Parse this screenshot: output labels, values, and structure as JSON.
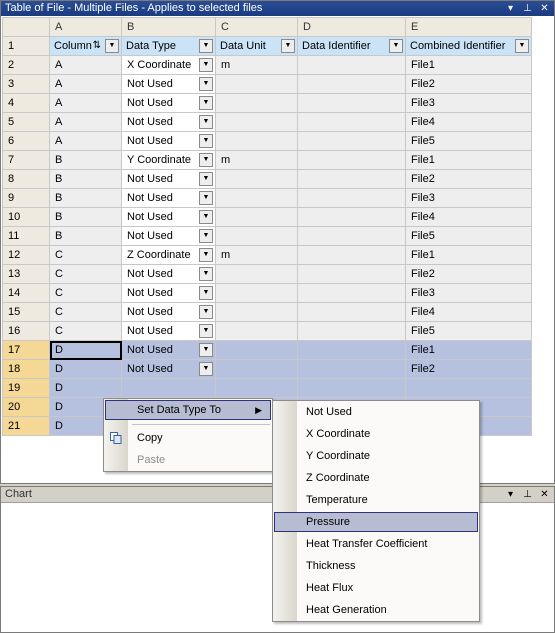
{
  "table_panel": {
    "title": "Table of File - Multiple Files - Applies to selected files",
    "buttons": [
      "▾",
      "⊥",
      "✕"
    ]
  },
  "columns": [
    "A",
    "B",
    "C",
    "D",
    "E"
  ],
  "header_row": {
    "row_number": "1",
    "column": "Column",
    "data_type": "Data Type",
    "data_unit": "Data Unit",
    "data_identifier": "Data Identifier",
    "combined_identifier": "Combined Identifier"
  },
  "rows": [
    {
      "n": "2",
      "a": "A",
      "b": "X Coordinate",
      "c": "m",
      "d": "",
      "e": "File1"
    },
    {
      "n": "3",
      "a": "A",
      "b": "Not Used",
      "c": "",
      "d": "",
      "e": "File2"
    },
    {
      "n": "4",
      "a": "A",
      "b": "Not Used",
      "c": "",
      "d": "",
      "e": "File3"
    },
    {
      "n": "5",
      "a": "A",
      "b": "Not Used",
      "c": "",
      "d": "",
      "e": "File4"
    },
    {
      "n": "6",
      "a": "A",
      "b": "Not Used",
      "c": "",
      "d": "",
      "e": "File5"
    },
    {
      "n": "7",
      "a": "B",
      "b": "Y Coordinate",
      "c": "m",
      "d": "",
      "e": "File1"
    },
    {
      "n": "8",
      "a": "B",
      "b": "Not Used",
      "c": "",
      "d": "",
      "e": "File2"
    },
    {
      "n": "9",
      "a": "B",
      "b": "Not Used",
      "c": "",
      "d": "",
      "e": "File3"
    },
    {
      "n": "10",
      "a": "B",
      "b": "Not Used",
      "c": "",
      "d": "",
      "e": "File4"
    },
    {
      "n": "11",
      "a": "B",
      "b": "Not Used",
      "c": "",
      "d": "",
      "e": "File5"
    },
    {
      "n": "12",
      "a": "C",
      "b": "Z Coordinate",
      "c": "m",
      "d": "",
      "e": "File1"
    },
    {
      "n": "13",
      "a": "C",
      "b": "Not Used",
      "c": "",
      "d": "",
      "e": "File2"
    },
    {
      "n": "14",
      "a": "C",
      "b": "Not Used",
      "c": "",
      "d": "",
      "e": "File3"
    },
    {
      "n": "15",
      "a": "C",
      "b": "Not Used",
      "c": "",
      "d": "",
      "e": "File4"
    },
    {
      "n": "16",
      "a": "C",
      "b": "Not Used",
      "c": "",
      "d": "",
      "e": "File5"
    },
    {
      "n": "17",
      "a": "D",
      "b": "Not Used",
      "c": "",
      "d": "",
      "e": "File1",
      "selected": true
    },
    {
      "n": "18",
      "a": "D",
      "b": "Not Used",
      "c": "",
      "d": "",
      "e": "File2",
      "selected": true
    },
    {
      "n": "19",
      "a": "D",
      "b": "",
      "c": "",
      "d": "",
      "e": "",
      "selected": true
    },
    {
      "n": "20",
      "a": "D",
      "b": "",
      "c": "",
      "d": "",
      "e": "",
      "selected": true
    },
    {
      "n": "21",
      "a": "D",
      "b": "",
      "c": "",
      "d": "",
      "e": "",
      "selected": true
    }
  ],
  "chart_panel": {
    "title": "Chart",
    "buttons": [
      "▾",
      "⊥",
      "✕"
    ]
  },
  "context_menu": {
    "set_data_type": "Set Data Type To",
    "copy": "Copy",
    "paste": "Paste"
  },
  "submenu": {
    "items": [
      "Not Used",
      "X Coordinate",
      "Y Coordinate",
      "Z Coordinate",
      "Temperature",
      "Pressure",
      "Heat Transfer Coefficient",
      "Thickness",
      "Heat Flux",
      "Heat Generation"
    ],
    "highlighted": "Pressure"
  },
  "colors": {
    "title_active": "#1a3b80",
    "header_blue": "#cbe3f6",
    "selection": "#b6c1df",
    "selected_rowhdr": "#f5d796",
    "menu_highlight": "#b6bdd2"
  }
}
